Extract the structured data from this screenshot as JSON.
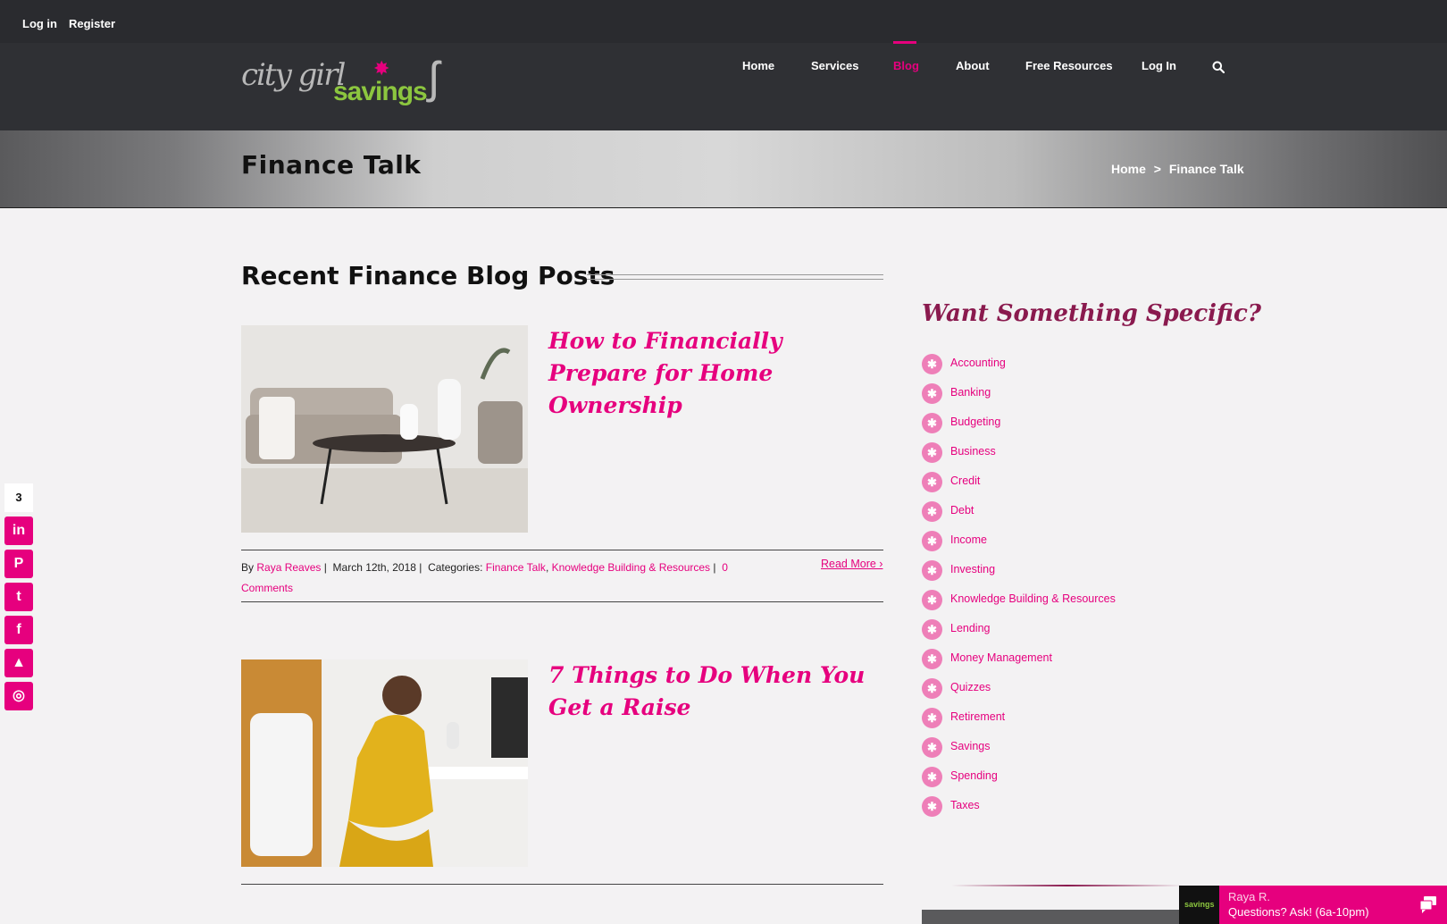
{
  "topbar": {
    "login": "Log in",
    "register": "Register"
  },
  "logo": {
    "script": "city girl",
    "brand": "savings",
    "star": "✸",
    "figure": "ʃ"
  },
  "nav": {
    "items": [
      "Home",
      "Services",
      "Blog",
      "About",
      "Free Resources",
      "Log In"
    ],
    "active": "Blog",
    "search_icon": "search-icon"
  },
  "banner": {
    "title": "Finance Talk",
    "breadcrumb": {
      "home": "Home",
      "separator": ">",
      "current": "Finance Talk"
    }
  },
  "main": {
    "section_title": "Recent Finance Blog Posts",
    "posts": [
      {
        "title": "How to Financially Prepare for Home Ownership",
        "image_alt": "living room with sofa and coffee table",
        "meta": {
          "by": "By",
          "author": "Raya Reaves",
          "date": "March 12th, 2018",
          "categories_label": "Categories:",
          "cat1": "Finance Talk",
          "cat2": "Knowledge Building & Resources",
          "comments_num": "0",
          "comments_word": "Comments"
        },
        "read_more": "Read More ›"
      },
      {
        "title": "7 Things to Do When You Get a Raise",
        "image_alt": "woman in yellow dress writing at desk"
      }
    ]
  },
  "sidebar": {
    "title": "Want Something Specific?",
    "bullet": "✱",
    "categories": [
      "Accounting",
      "Banking",
      "Budgeting",
      "Business",
      "Credit",
      "Debt",
      "Income",
      "Investing",
      "Knowledge Building & Resources",
      "Lending",
      "Money Management",
      "Quizzes",
      "Retirement",
      "Savings",
      "Spending",
      "Taxes"
    ]
  },
  "share": {
    "count": "3",
    "networks": [
      "in",
      "P",
      "t",
      "f",
      "▲",
      "◎"
    ]
  },
  "chat": {
    "name": "Raya R.",
    "text": "Questions? Ask! (6a-10pm)",
    "logo_text": "savings"
  },
  "colors": {
    "accent": "#e6007e",
    "brand_green": "#8cc63f",
    "header": "#2f3034",
    "sidebar_title": "#8a1a4e"
  }
}
